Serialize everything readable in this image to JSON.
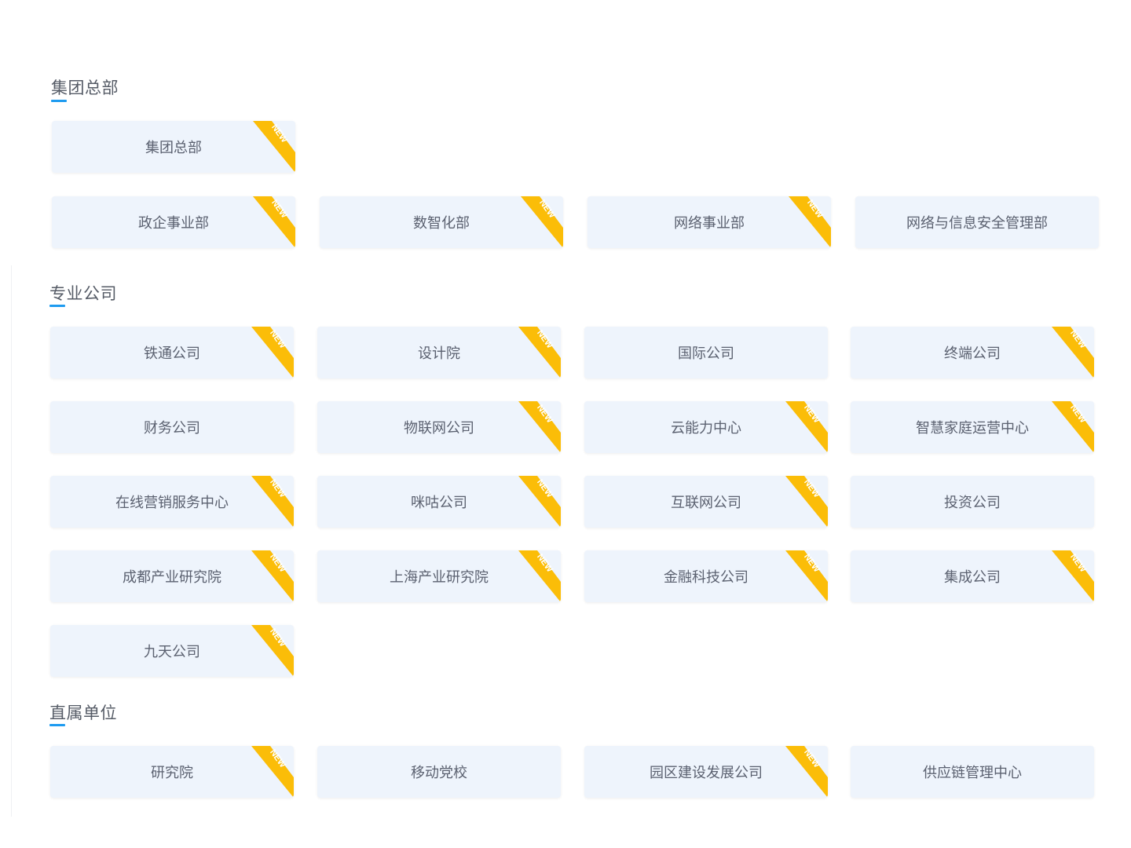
{
  "sections": [
    {
      "title": "集团总部",
      "items": [
        {
          "label": "集团总部",
          "badge": "NEW"
        },
        {
          "label": "政企事业部",
          "badge": "NEW"
        },
        {
          "label": "数智化部",
          "badge": "NEW"
        },
        {
          "label": "网络事业部",
          "badge": "NEW"
        },
        {
          "label": "网络与信息安全管理部",
          "badge": ""
        }
      ]
    },
    {
      "title": "专业公司",
      "items": [
        {
          "label": "铁通公司",
          "badge": "NEW"
        },
        {
          "label": "设计院",
          "badge": "NEW"
        },
        {
          "label": "国际公司",
          "badge": ""
        },
        {
          "label": "终端公司",
          "badge": "NEW"
        },
        {
          "label": "财务公司",
          "badge": ""
        },
        {
          "label": "物联网公司",
          "badge": "NEW"
        },
        {
          "label": "云能力中心",
          "badge": "NEW"
        },
        {
          "label": "智慧家庭运营中心",
          "badge": "NEW"
        },
        {
          "label": "在线营销服务中心",
          "badge": "NEW"
        },
        {
          "label": "咪咕公司",
          "badge": "NEW"
        },
        {
          "label": "互联网公司",
          "badge": "NEW"
        },
        {
          "label": "投资公司",
          "badge": ""
        },
        {
          "label": "成都产业研究院",
          "badge": "NEW"
        },
        {
          "label": "上海产业研究院",
          "badge": "NEW"
        },
        {
          "label": "金融科技公司",
          "badge": "NEW"
        },
        {
          "label": "集成公司",
          "badge": "NEW"
        },
        {
          "label": "九天公司",
          "badge": "NEW"
        }
      ]
    },
    {
      "title": "直属单位",
      "items": [
        {
          "label": "研究院",
          "badge": "NEW"
        },
        {
          "label": "移动党校",
          "badge": ""
        },
        {
          "label": "园区建设发展公司",
          "badge": "NEW"
        },
        {
          "label": "供应链管理中心",
          "badge": ""
        }
      ]
    }
  ],
  "colors": {
    "accent": "#1e9bf0",
    "card_bg": "#eef4fc",
    "badge_bg": "#fbbd08",
    "badge_text": "#ffffff",
    "label_text": "#5b6170"
  },
  "icons": {
    "badge": "new-ribbon-icon"
  }
}
